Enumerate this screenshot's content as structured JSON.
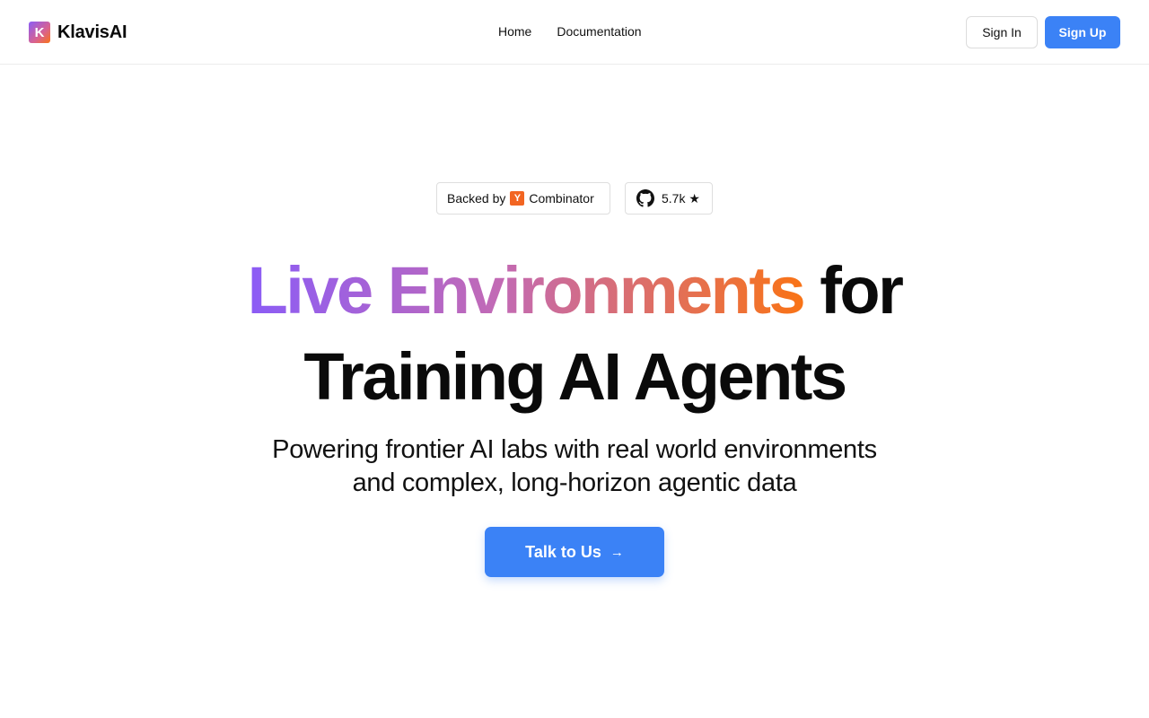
{
  "header": {
    "logo_letter": "K",
    "brand": "KlavisAI",
    "nav": [
      {
        "label": "Home"
      },
      {
        "label": "Documentation"
      }
    ],
    "sign_in_label": "Sign In",
    "sign_up_label": "Sign Up"
  },
  "badges": {
    "yc_prefix": "Backed by",
    "yc_letter": "Y",
    "yc_suffix": "Combinator",
    "github_stars": "5.7k ★",
    "github_icon": "github-icon"
  },
  "hero": {
    "title_gradient": "Live Environments",
    "title_rest": "for",
    "title_line2": "Training AI Agents",
    "subtitle_line1": "Powering frontier AI labs with real world environments",
    "subtitle_line2": "and complex, long-horizon agentic data",
    "cta_label": "Talk to Us",
    "cta_arrow": "→"
  },
  "colors": {
    "primary": "#3b82f6",
    "gradient_start": "#8b5cf6",
    "gradient_end": "#f97316",
    "yc_orange": "#f26522"
  }
}
